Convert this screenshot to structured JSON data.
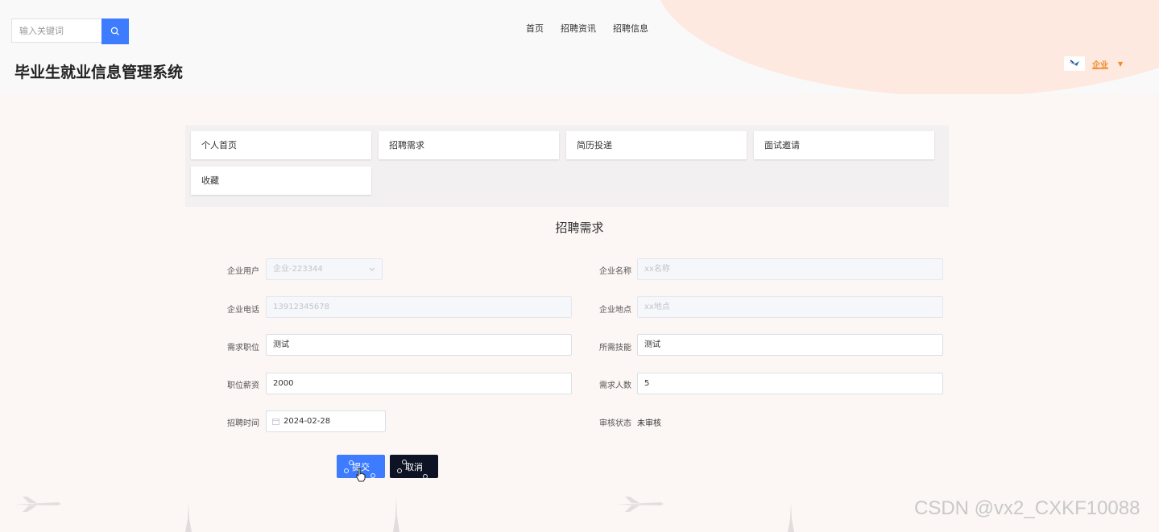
{
  "header": {
    "search_placeholder": "输入关键词",
    "nav": [
      "首页",
      "招聘资讯",
      "招聘信息"
    ],
    "site_title": "毕业生就业信息管理系统",
    "user_role": "企业"
  },
  "menu": {
    "tabs": [
      "个人首页",
      "招聘需求",
      "简历投递",
      "面试邀请",
      "收藏"
    ]
  },
  "page": {
    "title": "招聘需求"
  },
  "form": {
    "company_user_label": "企业用户",
    "company_user_value": "企业-223344",
    "company_name_label": "企业名称",
    "company_name_placeholder": "xx名称",
    "company_phone_label": "企业电话",
    "company_phone_value": "13912345678",
    "company_location_label": "企业地点",
    "company_location_placeholder": "xx地点",
    "position_label": "需求职位",
    "position_value": "测试",
    "skills_label": "所需技能",
    "skills_value": "测试",
    "salary_label": "职位薪资",
    "salary_value": "2000",
    "headcount_label": "需求人数",
    "headcount_value": "5",
    "date_label": "招聘时间",
    "date_value": "2024-02-28",
    "audit_label": "审核状态",
    "audit_value": "未审核",
    "submit_label": "提交",
    "cancel_label": "取消"
  },
  "watermark": "CSDN @vx2_CXKF10088",
  "colors": {
    "primary": "#3d7bff",
    "dark": "#0d1324",
    "accent": "#f08a28",
    "blob": "#fde9df"
  },
  "icons": [
    "search-icon",
    "chevron-down-icon",
    "calendar-icon",
    "avatar",
    "pointer-cursor-icon",
    "airplane-icon",
    "tower-icon"
  ]
}
